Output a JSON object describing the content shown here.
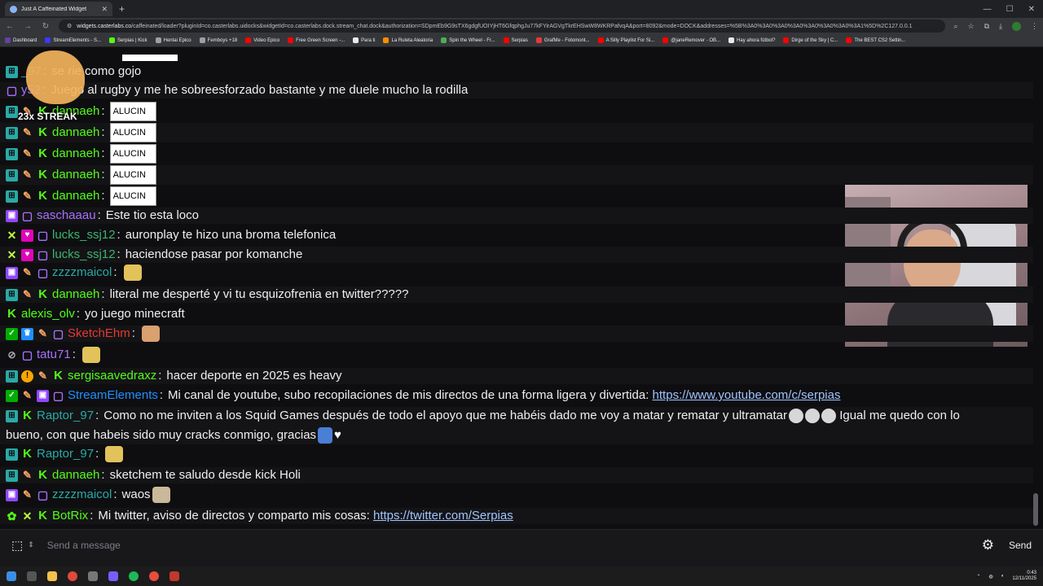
{
  "browser": {
    "tab_title": "Just A Caffeinated Widget",
    "url_host": "widgets.casterlabs.co",
    "url_rest": "/caffeinated/loader?pluginId=co.casterlabs.uidocks&widgetId=co.casterlabs.dock.stream_chat.dock&authorization=SDpmEb9G9sTX6gdgfUOIYjHT6GfqphgJu77kFYirAGVgTkrEHSwW8WKRPafvqA&port=8092&mode=DOCK&addresses=%5B%3A0%3A0%3A0%3A0%3A0%3A0%3A0%3A1%5D%2C127.0.0.1",
    "bookmarks": [
      {
        "label": "Dashboard",
        "color": "#6441a5"
      },
      {
        "label": "StreamElements - S...",
        "color": "#3a3aff"
      },
      {
        "label": "Serpias | Kick",
        "color": "#53fc18"
      },
      {
        "label": "Hentai Epico",
        "color": "#9aa0a6"
      },
      {
        "label": "Femboys +18",
        "color": "#9aa0a6"
      },
      {
        "label": "Video Epico",
        "color": "#ff0000"
      },
      {
        "label": "Free Green Screen -...",
        "color": "#ff0000"
      },
      {
        "label": "Para ti",
        "color": "#e8eaed"
      },
      {
        "label": "La Ruleta Aleatoria",
        "color": "#ff8c00"
      },
      {
        "label": "Spin the Wheel - Fr...",
        "color": "#4caf50"
      },
      {
        "label": "Serpias",
        "color": "#ff0000"
      },
      {
        "label": "GrafMe - Fotomont...",
        "color": "#e53935"
      },
      {
        "label": "A Silly Playlist For Si...",
        "color": "#ff0000"
      },
      {
        "label": "@janeRemover - OB...",
        "color": "#ff0000"
      },
      {
        "label": "Hay ahora fútbol?",
        "color": "#e8eaed"
      },
      {
        "label": "Dirge of the Sky | C...",
        "color": "#ff0000"
      },
      {
        "label": "The BEST CS2 Settin...",
        "color": "#ff0000"
      }
    ]
  },
  "overlay": {
    "streak_label": "23x STREAK"
  },
  "messages": [
    {
      "badges": [
        "mod"
      ],
      "user": "_97",
      "color": "#2aa9a6",
      "text": "se rie como gojo"
    },
    {
      "badges": [
        "twitch"
      ],
      "user": "y52",
      "color": "#a970ff",
      "text": "Juego al rugby y me he sobreesforzado bastante y me duele mucho la rodilla"
    },
    {
      "badges": [
        "mod",
        "bandage",
        "kick"
      ],
      "user": "dannaeh",
      "color": "#53fc18",
      "alucin": "ALUCIN"
    },
    {
      "badges": [
        "mod",
        "bandage",
        "kick"
      ],
      "user": "dannaeh",
      "color": "#53fc18",
      "alucin": "ALUCIN"
    },
    {
      "badges": [
        "mod",
        "bandage",
        "kick"
      ],
      "user": "dannaeh",
      "color": "#53fc18",
      "alucin": "ALUCIN"
    },
    {
      "badges": [
        "mod",
        "bandage",
        "kick"
      ],
      "user": "dannaeh",
      "color": "#53fc18",
      "alucin": "ALUCIN"
    },
    {
      "badges": [
        "mod",
        "bandage",
        "kick"
      ],
      "user": "dannaeh",
      "color": "#53fc18",
      "alucin": "ALUCIN"
    },
    {
      "badges": [
        "gift",
        "twitch"
      ],
      "user": "saschaaau",
      "color": "#a970ff",
      "text": "Este tio esta loco"
    },
    {
      "badges": [
        "xbox",
        "vip",
        "twitch"
      ],
      "user": "lucks_ssj12",
      "color": "#3cb371",
      "text": "auronplay te hizo una broma telefonica"
    },
    {
      "badges": [
        "xbox",
        "vip",
        "twitch"
      ],
      "user": "lucks_ssj12",
      "color": "#3cb371",
      "text": "haciendose pasar por komanche"
    },
    {
      "badges": [
        "gift",
        "bandage",
        "twitch"
      ],
      "user": "zzzzmaicol",
      "color": "#2aa9a6",
      "text": ""
    },
    {
      "badges": [
        "mod",
        "bandage",
        "kick"
      ],
      "user": "dannaeh",
      "color": "#53fc18",
      "text": "literal me desperté y vi tu esquizofrenia en twitter?????"
    },
    {
      "badges": [
        "kick"
      ],
      "user": "alexis_olv",
      "color": "#53fc18",
      "text": "yo juego minecraft"
    },
    {
      "badges": [
        "sub",
        "crown",
        "bandage",
        "twitch"
      ],
      "user": "SketchEhm",
      "color": "#e53935",
      "text": ""
    },
    {
      "badges": [
        "eye",
        "twitch"
      ],
      "user": "tatu71",
      "color": "#a970ff",
      "text": ""
    },
    {
      "badges": [
        "mod",
        "warn",
        "bandage",
        "kick"
      ],
      "user": "sergisaavedraxz",
      "color": "#53fc18",
      "text": "hacer deporte en 2025 es heavy"
    },
    {
      "badges": [
        "sub",
        "bandage",
        "gift",
        "twitch"
      ],
      "user": "StreamElements",
      "color": "#1e90ff",
      "text": "Mi canal de youtube, subo recopilaciones de mis directos de una forma ligera y divertida:",
      "link": "https://www.youtube.com/c/serpias"
    },
    {
      "badges": [
        "mod",
        "kick"
      ],
      "user": "Raptor_97",
      "color": "#2aa9a6",
      "text": "Como no me inviten a los Squid Games después de todo el apoyo que me habéis dado me voy a matar y rematar y ultramatar",
      "text2": "Igual me quedo con lo",
      "line2": "bueno, con que habeis sido muy cracks conmigo, gracias"
    },
    {
      "badges": [
        "mod",
        "kick"
      ],
      "user": "Raptor_97",
      "color": "#2aa9a6",
      "text": ""
    },
    {
      "badges": [
        "mod",
        "bandage",
        "kick"
      ],
      "user": "dannaeh",
      "color": "#53fc18",
      "text": "sketchem te saludo desde kick Holi"
    },
    {
      "badges": [
        "gift",
        "bandage",
        "twitch"
      ],
      "user": "zzzzmaicol",
      "color": "#2aa9a6",
      "text": "waos"
    },
    {
      "badges": [
        "bot",
        "xbox",
        "kick"
      ],
      "user": "BotRix",
      "color": "#53fc18",
      "text": "Mi twitter, aviso de directos y comparto mis cosas:",
      "link": "https://twitter.com/Serpias"
    }
  ],
  "input": {
    "placeholder": "Send a message",
    "send_label": "Send"
  },
  "taskbar": {
    "time": "0:43",
    "date": "12/11/2025"
  }
}
